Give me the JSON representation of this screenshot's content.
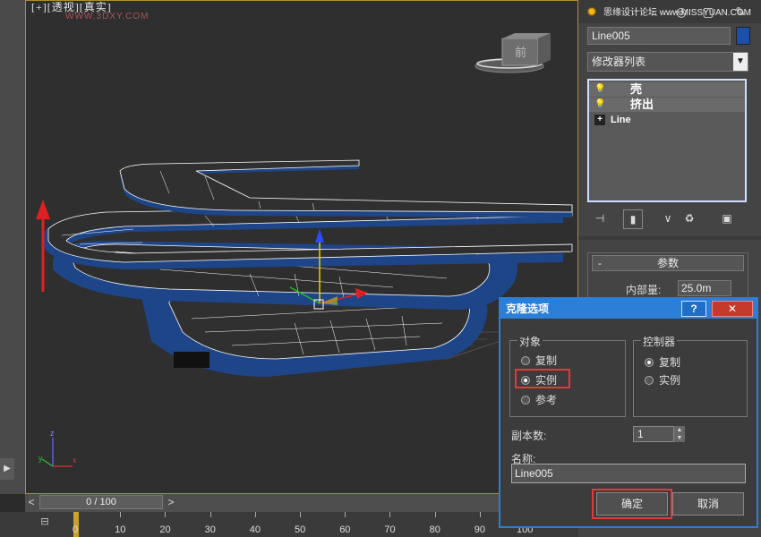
{
  "viewport": {
    "label": "[+][透视][真实]",
    "watermark": "WWW.3DXY.COM",
    "viewcube_label": "前"
  },
  "right_panel": {
    "toolbar_icons": [
      "sun-icon",
      "pipe-icon",
      "motion-icon",
      "display-icon",
      "utility-icon"
    ],
    "top_watermark": "思缘设计论坛 www.MISSYUAN.COM",
    "object_name": "Line005",
    "object_color": "#1c4fa8",
    "modifier_list_label": "修改器列表",
    "stack": [
      {
        "label": "壳",
        "icon": "bulb-icon"
      },
      {
        "label": "挤出",
        "icon": "bulb-icon"
      },
      {
        "label": "Line",
        "icon": "plus-icon"
      }
    ],
    "params_title": "参数",
    "params_minus": "-",
    "inner_label": "内部量:",
    "inner_value": "25.0m"
  },
  "timeline": {
    "slider_text": "0 / 100",
    "prev": "<",
    "next": ">",
    "ticks": [
      "0",
      "10",
      "20",
      "30",
      "40",
      "50",
      "60",
      "70",
      "80",
      "90",
      "100"
    ]
  },
  "dialog": {
    "title": "克隆选项",
    "help": "?",
    "close": "✕",
    "object_group": {
      "title": "对象",
      "options": [
        "复制",
        "实例",
        "参考"
      ],
      "selected": "实例"
    },
    "controller_group": {
      "title": "控制器",
      "options": [
        "复制",
        "实例"
      ],
      "selected": "复制"
    },
    "copies_label": "副本数:",
    "copies_value": "1",
    "name_label": "名称:",
    "name_value": "Line005",
    "ok_label": "确定",
    "cancel_label": "取消",
    "highlight_color": "#e23a3a"
  }
}
